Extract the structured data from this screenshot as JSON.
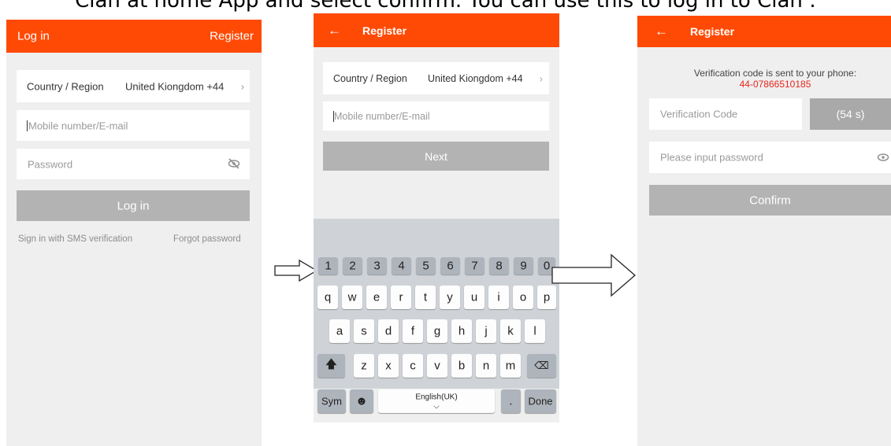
{
  "caption": "Clan at home App and select confirm. You can use this to log in to Clan :",
  "screen1": {
    "title": "Log in",
    "register": "Register",
    "country_label": "Country / Region",
    "country_value": "United Kiongdom +44",
    "mobile_placeholder": "Mobile number/E-mail",
    "password_placeholder": "Password",
    "login_button": "Log in",
    "sms_link": "Sign in with SMS verification",
    "forgot_link": "Forgot password"
  },
  "screen2": {
    "title": "Register",
    "country_label": "Country / Region",
    "country_value": "United Kiongdom +44",
    "mobile_placeholder": "Mobile number/E-mail",
    "next_button": "Next",
    "keyboard": {
      "numbers": [
        "1",
        "2",
        "3",
        "4",
        "5",
        "6",
        "7",
        "8",
        "9",
        "0"
      ],
      "row1": [
        "q",
        "w",
        "e",
        "r",
        "t",
        "y",
        "u",
        "i",
        "o",
        "p"
      ],
      "row2": [
        "a",
        "s",
        "d",
        "f",
        "g",
        "h",
        "j",
        "k",
        "l"
      ],
      "row3": [
        "z",
        "x",
        "c",
        "v",
        "b",
        "n",
        "m"
      ],
      "sym": "Sym",
      "space": "English(UK)",
      "done": "Done"
    }
  },
  "screen3": {
    "title": "Register",
    "info": "Verification code is sent to your phone:",
    "phone": "44-07866510185",
    "code_placeholder": "Verification Code",
    "timer": "(54 s)",
    "password_placeholder": "Please input password",
    "confirm_button": "Confirm"
  },
  "colors": {
    "accent": "#ff4a05",
    "phone_red": "#e8261c",
    "button_gray": "#b3b3b3"
  }
}
